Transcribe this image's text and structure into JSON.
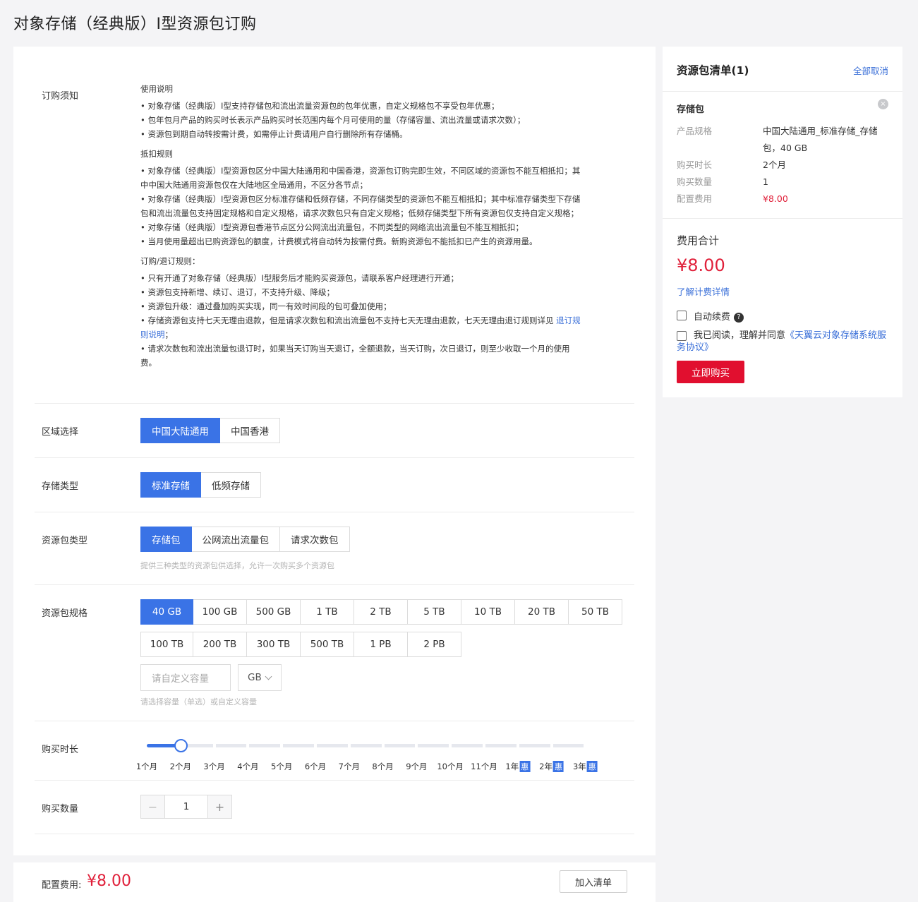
{
  "page_title": "对象存储（经典版）I型资源包订购",
  "notice": {
    "label": "订购须知",
    "usage_title": "使用说明",
    "usage_items": [
      "对象存储（经典版）I型支持存储包和流出流量资源包的包年优惠，自定义规格包不享受包年优惠；",
      "包年包月产品的购买时长表示产品购买时长范围内每个月可使用的量（存储容量、流出流量或请求次数）；",
      "资源包到期自动转按需计费，如需停止计费请用户自行删除所有存储桶。"
    ],
    "deduct_title": "抵扣规则",
    "deduct_items": [
      "对象存储（经典版）I型资源包区分中国大陆通用和中国香港，资源包订购完即生效，不同区域的资源包不能互相抵扣；其中中国大陆通用资源包仅在大陆地区全局通用，不区分各节点；",
      "对象存储（经典版）I型资源包区分标准存储和低频存储，不同存储类型的资源包不能互相抵扣；其中标准存储类型下存储包和流出流量包支持固定规格和自定义规格，请求次数包只有自定义规格；低频存储类型下所有资源包仅支持自定义规格；",
      "对象存储（经典版）I型资源包香港节点区分公网流出流量包，不同类型的网络流出流量包不能互相抵扣；",
      "当月使用量超出已购资源包的额度，计费模式将自动转为按需付费。新购资源包不能抵扣已产生的资源用量。"
    ],
    "order_title": "订购/退订规则：",
    "order_items": [
      "只有开通了对象存储（经典版）I型服务后才能购买资源包，请联系客户经理进行开通；",
      "资源包支持新增、续订、退订，不支持升级、降级；",
      "资源包升级：通过叠加购买实现，同一有效时间段的包可叠加使用；"
    ],
    "refund_item_text": "存储资源包支持七天无理由退款，但是请求次数包和流出流量包不支持七天无理由退款，七天无理由退订规则详见 ",
    "refund_link": "退订规则说明",
    "refund_tail": "；",
    "last_item": "请求次数包和流出流量包退订时，如果当天订购当天退订，全额退款，当天订购，次日退订，则至少收取一个月的使用费。"
  },
  "region": {
    "label": "区域选择",
    "options": [
      "中国大陆通用",
      "中国香港"
    ]
  },
  "storage_type": {
    "label": "存储类型",
    "options": [
      "标准存储",
      "低频存储"
    ]
  },
  "package_type": {
    "label": "资源包类型",
    "options": [
      "存储包",
      "公网流出流量包",
      "请求次数包"
    ],
    "hint": "提供三种类型的资源包供选择，允许一次购买多个资源包"
  },
  "package_size": {
    "label": "资源包规格",
    "row1": [
      "40 GB",
      "100 GB",
      "500 GB",
      "1 TB",
      "2 TB",
      "5 TB",
      "10 TB",
      "20 TB",
      "50 TB"
    ],
    "row2": [
      "100 TB",
      "200 TB",
      "300 TB",
      "500 TB",
      "1 PB",
      "2 PB"
    ],
    "custom_placeholder": "请自定义容量",
    "unit": "GB",
    "hint": "请选择容量（单选）或自定义容量"
  },
  "duration": {
    "label": "购买时长",
    "ticks": [
      "1个月",
      "2个月",
      "3个月",
      "4个月",
      "5个月",
      "6个月",
      "7个月",
      "8个月",
      "9个月",
      "10个月",
      "11个月",
      "1年",
      "2年",
      "3年"
    ],
    "discount_badge": "惠",
    "selected": "2个月"
  },
  "quantity": {
    "label": "购买数量",
    "minus": "−",
    "value": "1",
    "plus": "+"
  },
  "footer": {
    "fee_label": "配置费用:",
    "fee_value": "¥8.00",
    "add_button": "加入清单"
  },
  "cart": {
    "title": "资源包清单(1)",
    "cancel_all": "全部取消",
    "item_title": "存储包",
    "close_icon": "×",
    "spec_key": "产品规格",
    "spec_value": "中国大陆通用_标准存储_存储包，40 GB",
    "duration_key": "购买时长",
    "duration_value": "2个月",
    "qty_key": "购买数量",
    "qty_value": "1",
    "fee_key": "配置费用",
    "fee_value": "¥8.00",
    "total_label": "费用合计",
    "total_value": "¥8.00",
    "fee_detail_link": "了解计费详情",
    "auto_renew": "自动续费",
    "help_icon": "?",
    "agree_text": "我已阅读，理解并同意",
    "agree_link": "《天翼云对象存储系统服务协议》",
    "buy_button": "立即购买"
  },
  "colors": {
    "primary": "#3a73e6",
    "price": "#e0203a",
    "buy": "#e10f2f",
    "link": "#3a6fd8"
  }
}
